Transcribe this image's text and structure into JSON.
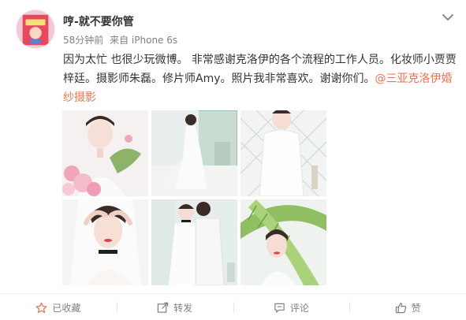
{
  "post": {
    "username": "哼-就不要你管",
    "time": "58分钟前",
    "source": "来自 iPhone 6s",
    "text_before": "因为太忙 也很少玩微博。 非常感谢克洛伊的各个流程的工作人员。化妆师小贾贾梓廷。摄影师朱磊。修片师Amy。照片我非常喜欢。谢谢你们。",
    "mention": "@三亚克洛伊婚纱摄影"
  },
  "actions": {
    "favorite": "已收藏",
    "repost": "转发",
    "comment": "评论",
    "like": "赞"
  },
  "colors": {
    "accent": "#eb7350",
    "muted": "#808080",
    "favorite_icon": "#eb7350"
  },
  "icons": {
    "favorite": "star-icon",
    "repost": "share-icon",
    "comment": "comment-icon",
    "like": "thumbs-up-icon",
    "menu": "chevron-down-icon"
  }
}
